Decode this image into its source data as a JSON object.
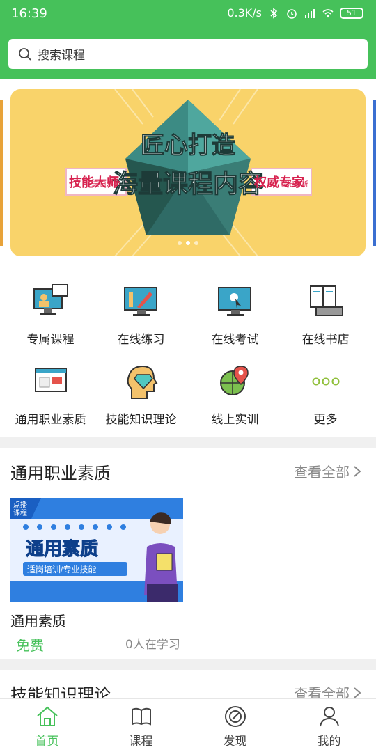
{
  "status_bar": {
    "time": "16:39",
    "network_speed": "0.3K/s",
    "battery": "51"
  },
  "search": {
    "placeholder": "搜索课程"
  },
  "banner": {
    "headline_1": "匠心打造",
    "headline_2": "海量课程内容",
    "left_tag_main": "技能大师",
    "left_tag_sub": "亲自示范",
    "right_tag_main": "权威专家",
    "right_tag_sub": "精准解析"
  },
  "categories": [
    {
      "label": "专属课程",
      "icon": "monitor-teacher-icon"
    },
    {
      "label": "在线练习",
      "icon": "ruler-pencil-monitor-icon"
    },
    {
      "label": "在线考试",
      "icon": "monitor-cursor-icon"
    },
    {
      "label": "在线书店",
      "icon": "book-keyboard-icon"
    },
    {
      "label": "通用职业素质",
      "icon": "video-page-icon"
    },
    {
      "label": "技能知识理论",
      "icon": "head-diamond-icon"
    },
    {
      "label": "线上实训",
      "icon": "globe-pin-icon"
    },
    {
      "label": "更多",
      "icon": "more-dots-icon"
    }
  ],
  "section1": {
    "title": "通用职业素质",
    "view_all": "查看全部",
    "course": {
      "badge_line1": "点播",
      "badge_line2": "课程",
      "thumb_title": "通用素质",
      "thumb_subtitle": "适岗培训/专业技能",
      "name": "通用素质",
      "price": "免费",
      "learners": "0人在学习"
    }
  },
  "section2": {
    "title": "技能知识理论",
    "view_all": "查看全部"
  },
  "bottom_nav": [
    {
      "label": "首页",
      "icon": "home-icon",
      "active": true
    },
    {
      "label": "课程",
      "icon": "book-icon",
      "active": false
    },
    {
      "label": "发现",
      "icon": "compass-icon",
      "active": false
    },
    {
      "label": "我的",
      "icon": "user-icon",
      "active": false
    }
  ],
  "colors": {
    "primary": "#46c15a",
    "banner_bg": "#f9d36a",
    "gem_dark": "#2f6b66",
    "gem_light": "#4fa79e"
  }
}
